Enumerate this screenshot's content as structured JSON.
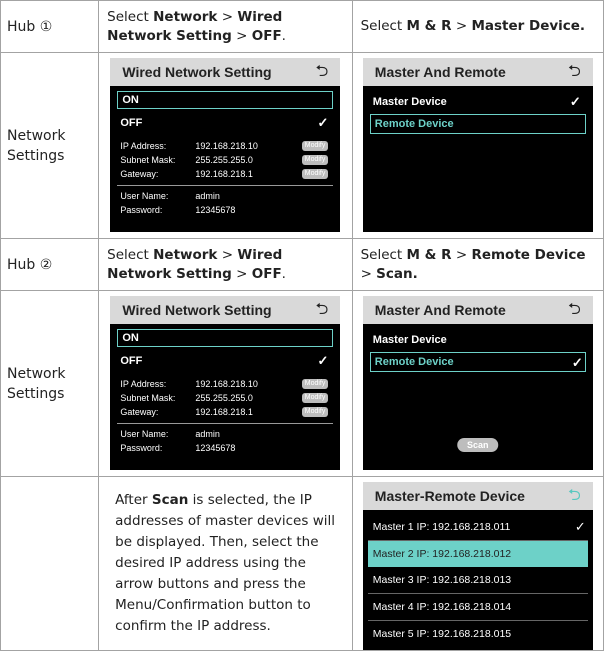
{
  "hub1": {
    "label": "Hub ①",
    "step_left": [
      "Select ",
      "Network",
      " > ",
      "Wired Network Setting",
      " > ",
      "OFF",
      "."
    ],
    "step_right": [
      "Select ",
      "M & R",
      " > ",
      "Master Device.",
      "",
      "",
      ""
    ]
  },
  "row_label": "Network Settings",
  "wired": {
    "title": "Wired Network Setting",
    "on": "ON",
    "off": "OFF",
    "ip_label": "IP Address:",
    "ip_value": "192.168.218.10",
    "mask_label": "Subnet Mask:",
    "mask_value": "255.255.255.0",
    "gw_label": "Gateway:",
    "gw_value": "192.168.218.1",
    "modify": "Modify",
    "user_label": "User Name:",
    "user_value": "admin",
    "pass_label": "Password:",
    "pass_value": "12345678"
  },
  "mr": {
    "title": "Master And Remote",
    "master": "Master Device",
    "remote": "Remote Device",
    "scan": "Scan"
  },
  "hub2": {
    "label": "Hub ②",
    "step_left": [
      "Select ",
      "Network",
      " > ",
      "Wired Network Setting",
      " > ",
      "OFF",
      "."
    ],
    "step_right": [
      "Select ",
      "M & R",
      " > ",
      "Remote Device",
      " > ",
      "Scan.",
      ""
    ]
  },
  "scan_note": {
    "pre": "After ",
    "bold": "Scan",
    "post": " is selected, the IP addresses of master devices will be displayed. Then, select the desired IP address using the arrow buttons and press the Menu/Confirmation button to confirm the IP address."
  },
  "mrd": {
    "title": "Master-Remote Device",
    "items": [
      "Master 1 IP:  192.168.218.011",
      "Master 2 IP: 192.168.218.012",
      "Master 3 IP: 192.168.218.013",
      "Master 4 IP: 192.168.218.014",
      "Master 5 IP: 192.168.218.015"
    ]
  },
  "icons": {
    "back": "back-arrow-icon",
    "check": "checkmark-icon"
  },
  "colors": {
    "accent": "#6dd1c8",
    "header": "#d9d9d9",
    "screen": "#000000"
  }
}
